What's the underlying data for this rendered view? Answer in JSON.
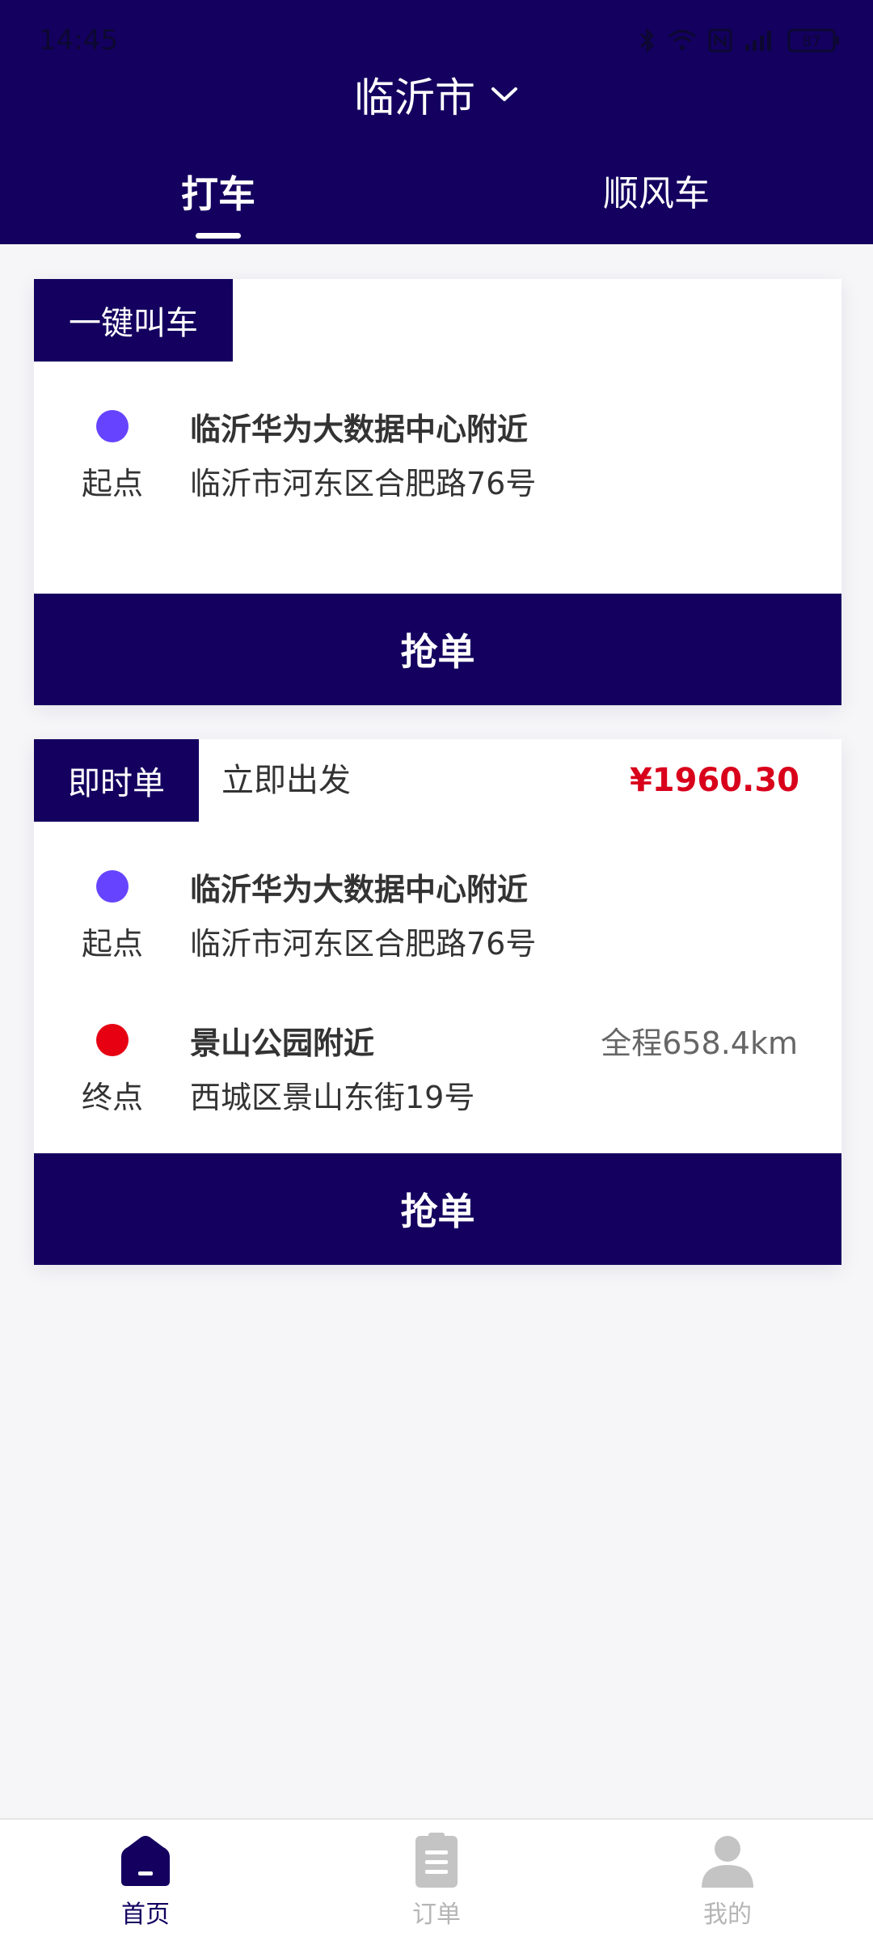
{
  "status_bar": {
    "time": "14:45",
    "battery": "87"
  },
  "header": {
    "city": "临沂市",
    "tabs": [
      {
        "label": "打车",
        "active": true
      },
      {
        "label": "顺风车",
        "active": false
      }
    ]
  },
  "card_quick": {
    "tag": "一键叫车",
    "start": {
      "label": "起点",
      "place": "临沂华为大数据中心附近",
      "address": "临沂市河东区合肥路76号"
    },
    "button": "抢单"
  },
  "card_instant": {
    "tag": "即时单",
    "subtitle": "立即出发",
    "price": "¥1960.30",
    "start": {
      "label": "起点",
      "place": "临沂华为大数据中心附近",
      "address": "临沂市河东区合肥路76号"
    },
    "end": {
      "label": "终点",
      "place": "景山公园附近",
      "address": "西城区景山东街19号",
      "distance": "全程658.4km"
    },
    "button": "抢单"
  },
  "bottom_nav": [
    {
      "label": "首页",
      "icon": "home-icon",
      "active": true
    },
    {
      "label": "订单",
      "icon": "clipboard-icon",
      "active": false
    },
    {
      "label": "我的",
      "icon": "user-icon",
      "active": false
    }
  ],
  "colors": {
    "primary": "#14005f",
    "start_dot": "#6644ff",
    "end_dot": "#e60012",
    "price": "#d9001b",
    "background": "#f6f6f8"
  }
}
